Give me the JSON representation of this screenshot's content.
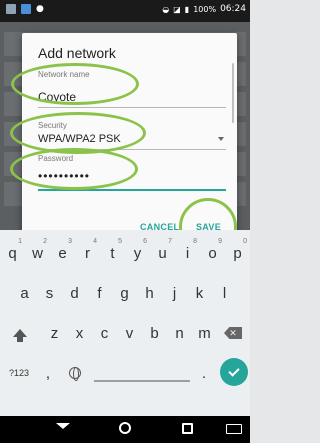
{
  "status_bar": {
    "battery": "100%",
    "time": "06:24"
  },
  "dialog": {
    "title": "Add network",
    "network_name_label": "Network name",
    "network_name_value": "Coyote",
    "security_label": "Security",
    "security_value": "WPA/WPA2 PSK",
    "password_label": "Password",
    "password_value": "••••••••••",
    "cancel_label": "CANCEL",
    "save_label": "SAVE"
  },
  "keyboard": {
    "row1": [
      {
        "key": "q",
        "hint": "1"
      },
      {
        "key": "w",
        "hint": "2"
      },
      {
        "key": "e",
        "hint": "3"
      },
      {
        "key": "r",
        "hint": "4"
      },
      {
        "key": "t",
        "hint": "5"
      },
      {
        "key": "y",
        "hint": "6"
      },
      {
        "key": "u",
        "hint": "7"
      },
      {
        "key": "i",
        "hint": "8"
      },
      {
        "key": "o",
        "hint": "9"
      },
      {
        "key": "p",
        "hint": "0"
      }
    ],
    "row2": [
      "a",
      "s",
      "d",
      "f",
      "g",
      "h",
      "j",
      "k",
      "l"
    ],
    "row3": [
      "z",
      "x",
      "c",
      "v",
      "b",
      "n",
      "m"
    ],
    "symbols_label": "?123",
    "comma": ",",
    "period": "."
  },
  "colors": {
    "accent": "#26a69a",
    "annotation": "#8bc34a"
  }
}
